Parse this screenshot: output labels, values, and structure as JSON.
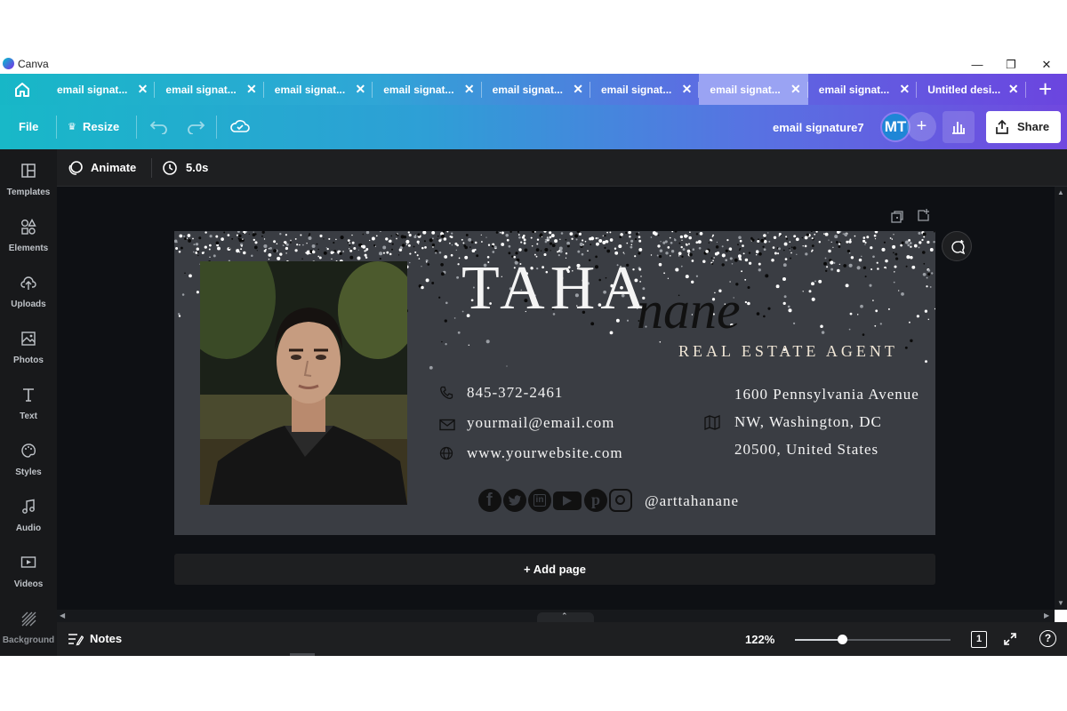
{
  "window": {
    "app_title": "Canva",
    "minimize": "—",
    "restore": "❐",
    "close": "✕"
  },
  "tabs": [
    {
      "label": "email signat...",
      "active": false
    },
    {
      "label": "email signat...",
      "active": false
    },
    {
      "label": "email signat...",
      "active": false
    },
    {
      "label": "email signat...",
      "active": false
    },
    {
      "label": "email signat...",
      "active": false
    },
    {
      "label": "email signat...",
      "active": false
    },
    {
      "label": "email signat...",
      "active": true
    },
    {
      "label": "email signat...",
      "active": false
    },
    {
      "label": "Untitled desi...",
      "active": false
    }
  ],
  "tab_close": "✕",
  "new_tab": "+",
  "toolbar": {
    "file": "File",
    "resize": "Resize",
    "doc_title": "email signature7",
    "avatar": "MT",
    "add": "+",
    "share": "Share"
  },
  "sidebar": [
    {
      "label": "Templates",
      "icon": "templates-icon"
    },
    {
      "label": "Elements",
      "icon": "elements-icon"
    },
    {
      "label": "Uploads",
      "icon": "uploads-icon"
    },
    {
      "label": "Photos",
      "icon": "photos-icon"
    },
    {
      "label": "Text",
      "icon": "text-icon"
    },
    {
      "label": "Styles",
      "icon": "styles-icon"
    },
    {
      "label": "Audio",
      "icon": "audio-icon"
    },
    {
      "label": "Videos",
      "icon": "videos-icon"
    },
    {
      "label": "Background",
      "icon": "background-icon"
    }
  ],
  "editbar": {
    "animate": "Animate",
    "duration": "5.0s"
  },
  "design": {
    "first_name": "TAHA",
    "script_name": "nane",
    "role": "REAL ESTATE AGENT",
    "phone": "845-372-2461",
    "email": "yourmail@email.com",
    "website": "www.yourwebsite.com",
    "address_line1": "1600 Pennsylvania Avenue",
    "address_line2": "NW, Washington, DC",
    "address_line3": "20500, United States",
    "handle": "@arttahanane",
    "background_color": "#3a3d43"
  },
  "add_page": "+ Add page",
  "bottombar": {
    "notes": "Notes",
    "zoom": "122%",
    "zoom_level": 0.3,
    "page_count": "1",
    "help": "?"
  },
  "colors": {
    "accent_teal": "#18b8c8",
    "accent_purple": "#7048df",
    "editor_dark": "#0e1014"
  }
}
